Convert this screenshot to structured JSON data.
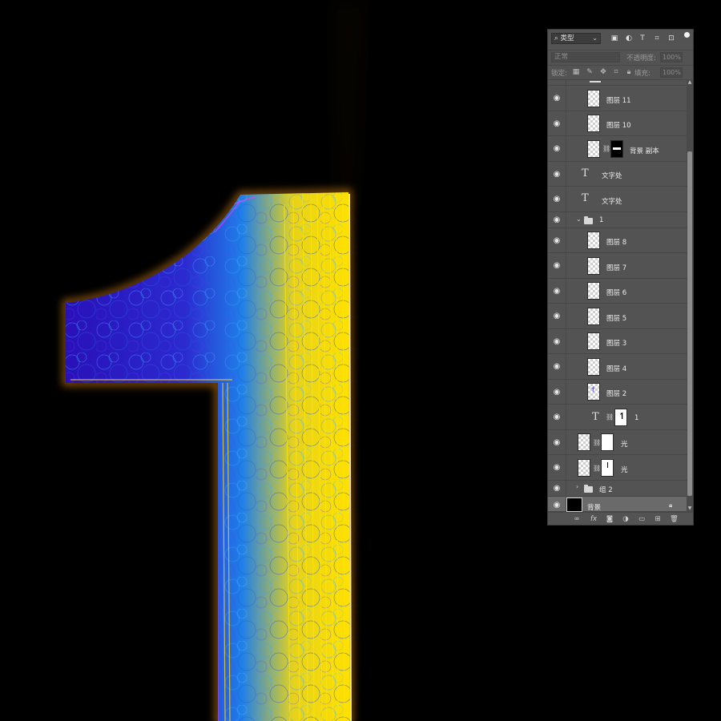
{
  "artwork": {
    "glyph": "1"
  },
  "panel": {
    "filter_kind": "类型",
    "blend_mode": "正常",
    "opacity_label": "不透明度:",
    "opacity_value": "100%",
    "lock_label": "锁定:",
    "fill_label": "填充:",
    "fill_value": "100%",
    "layers": [
      {
        "name": "图层 11",
        "kind": "pixel"
      },
      {
        "name": "图层 10",
        "kind": "pixel"
      },
      {
        "name": "背景 副本",
        "kind": "smart-masked"
      },
      {
        "name": "文字处",
        "kind": "text"
      },
      {
        "name": "文字处",
        "kind": "text"
      },
      {
        "name": "1",
        "kind": "group-open"
      },
      {
        "name": "图层 8",
        "kind": "pixel"
      },
      {
        "name": "图层 7",
        "kind": "pixel"
      },
      {
        "name": "图层 6",
        "kind": "pixel"
      },
      {
        "name": "图层 5",
        "kind": "pixel"
      },
      {
        "name": "图层 3",
        "kind": "pixel"
      },
      {
        "name": "图层 4",
        "kind": "pixel"
      },
      {
        "name": "图层 2",
        "kind": "pixel"
      },
      {
        "name": "1",
        "kind": "text-masked"
      },
      {
        "name": "光",
        "kind": "smart-masked"
      },
      {
        "name": "光",
        "kind": "smart-masked"
      },
      {
        "name": "组 2",
        "kind": "group-closed"
      },
      {
        "name": "背景",
        "kind": "background"
      }
    ]
  }
}
